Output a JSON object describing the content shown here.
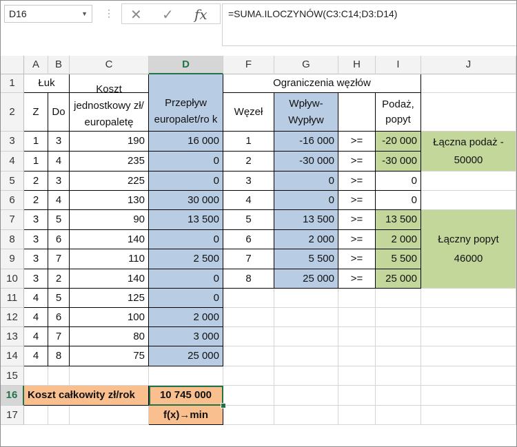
{
  "name_box": "D16",
  "formula": "=SUMA.ILOCZYNÓW(C3:C14;D3:D14)",
  "fx_symbol": "fx",
  "cancel_symbol": "✕",
  "enter_symbol": "✓",
  "columns": [
    "A",
    "B",
    "C",
    "D",
    "F",
    "G",
    "H",
    "I",
    "J"
  ],
  "rows": [
    "1",
    "2",
    "3",
    "4",
    "5",
    "6",
    "7",
    "8",
    "9",
    "10",
    "11",
    "12",
    "13",
    "14",
    "15",
    "16",
    "17"
  ],
  "header": {
    "luk": "Łuk",
    "ograniczenia": "Ograniczenia węzłów",
    "z": "Z",
    "do": "Do",
    "koszt": "Koszt jednostkowy zł/ europaletę",
    "przeplyw": "Przepływ europalet/ro k",
    "wezel": "Węzeł",
    "wplyw": "Wpływ- Wypływ",
    "podaz": "Podaż, popyt"
  },
  "arcs": [
    {
      "z": "1",
      "do": "3",
      "koszt": "190",
      "przeplyw": "16 000"
    },
    {
      "z": "1",
      "do": "4",
      "koszt": "235",
      "przeplyw": "0"
    },
    {
      "z": "2",
      "do": "3",
      "koszt": "225",
      "przeplyw": "0"
    },
    {
      "z": "2",
      "do": "4",
      "koszt": "130",
      "przeplyw": "30 000"
    },
    {
      "z": "3",
      "do": "5",
      "koszt": "90",
      "przeplyw": "13 500"
    },
    {
      "z": "3",
      "do": "6",
      "koszt": "140",
      "przeplyw": "0"
    },
    {
      "z": "3",
      "do": "7",
      "koszt": "110",
      "przeplyw": "2 500"
    },
    {
      "z": "3",
      "do": "2",
      "koszt": "140",
      "przeplyw": "0"
    },
    {
      "z": "4",
      "do": "5",
      "koszt": "125",
      "przeplyw": "0"
    },
    {
      "z": "4",
      "do": "6",
      "koszt": "100",
      "przeplyw": "2 000"
    },
    {
      "z": "4",
      "do": "7",
      "koszt": "80",
      "przeplyw": "3 000"
    },
    {
      "z": "4",
      "do": "8",
      "koszt": "75",
      "przeplyw": "25 000"
    }
  ],
  "nodes": [
    {
      "wezel": "1",
      "bilans": "-16 000",
      "rel": ">=",
      "podaz": "-20 000"
    },
    {
      "wezel": "2",
      "bilans": "-30 000",
      "rel": ">=",
      "podaz": "-30 000"
    },
    {
      "wezel": "3",
      "bilans": "0",
      "rel": ">=",
      "podaz": "0"
    },
    {
      "wezel": "4",
      "bilans": "0",
      "rel": ">=",
      "podaz": "0"
    },
    {
      "wezel": "5",
      "bilans": "13 500",
      "rel": ">=",
      "podaz": "13 500"
    },
    {
      "wezel": "6",
      "bilans": "2 000",
      "rel": ">=",
      "podaz": "2 000"
    },
    {
      "wezel": "7",
      "bilans": "5 500",
      "rel": ">=",
      "podaz": "5 500"
    },
    {
      "wezel": "8",
      "bilans": "25 000",
      "rel": ">=",
      "podaz": "25 000"
    }
  ],
  "laczna_podaz": {
    "line1": "Łączna podaż -",
    "line2": "50000"
  },
  "laczny_popyt": {
    "line1": "Łączny popyt",
    "line2": "46000"
  },
  "koszt_label": "Koszt całkowity zł/rok",
  "koszt_value": "10 745 000",
  "objective": "f(x)→min",
  "colors": {
    "blue": "#b8cce4",
    "green": "#c4d79b",
    "orange": "#fabf8f",
    "excel_green": "#217346"
  }
}
